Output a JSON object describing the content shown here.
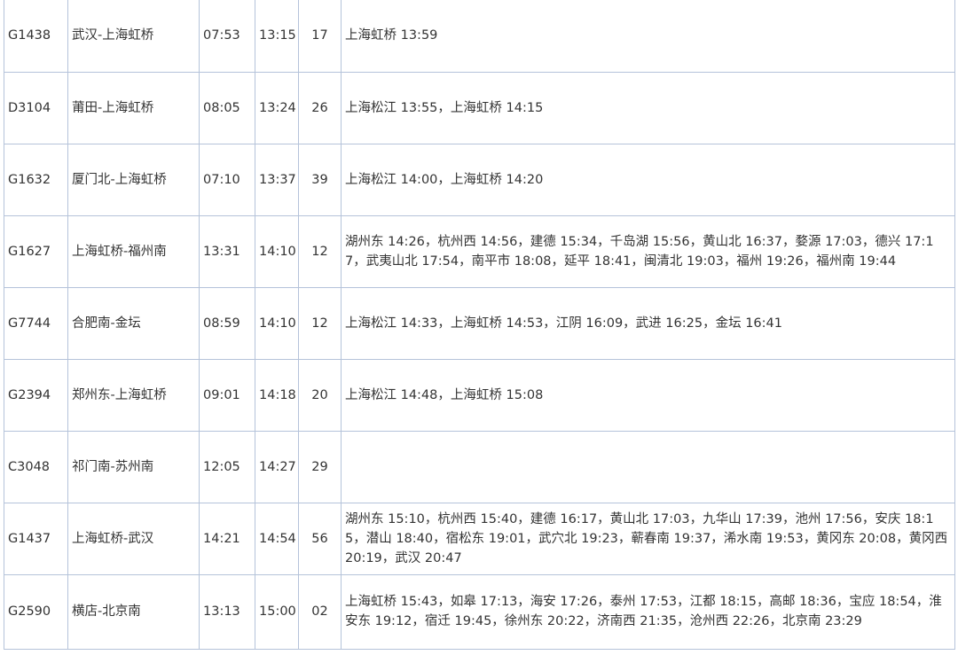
{
  "rows": [
    {
      "train": "G1438",
      "route": "武汉-上海虹桥",
      "depart": "07:53",
      "arrive": "13:15",
      "min": "17",
      "stops": "上海虹桥 13:59"
    },
    {
      "train": "D3104",
      "route": "莆田-上海虹桥",
      "depart": "08:05",
      "arrive": "13:24",
      "min": "26",
      "stops": "上海松江 13:55，上海虹桥 14:15"
    },
    {
      "train": "G1632",
      "route": "厦门北-上海虹桥",
      "depart": "07:10",
      "arrive": "13:37",
      "min": "39",
      "stops": "上海松江 14:00，上海虹桥 14:20"
    },
    {
      "train": "G1627",
      "route": "上海虹桥-福州南",
      "depart": "13:31",
      "arrive": "14:10",
      "min": "12",
      "stops": "湖州东 14:26，杭州西 14:56，建德 15:34，千岛湖 15:56，黄山北 16:37，婺源 17:03，德兴 17:17，武夷山北 17:54，南平市 18:08，延平 18:41，闽清北 19:03，福州 19:26，福州南 19:44"
    },
    {
      "train": "G7744",
      "route": "合肥南-金坛",
      "depart": "08:59",
      "arrive": "14:10",
      "min": "12",
      "stops": "上海松江 14:33，上海虹桥 14:53，江阴 16:09，武进 16:25，金坛 16:41"
    },
    {
      "train": "G2394",
      "route": "郑州东-上海虹桥",
      "depart": "09:01",
      "arrive": "14:18",
      "min": "20",
      "stops": "上海松江 14:48，上海虹桥 15:08"
    },
    {
      "train": "C3048",
      "route": "祁门南-苏州南",
      "depart": "12:05",
      "arrive": "14:27",
      "min": "29",
      "stops": ""
    },
    {
      "train": "G1437",
      "route": "上海虹桥-武汉",
      "depart": "14:21",
      "arrive": "14:54",
      "min": "56",
      "stops": "湖州东 15:10，杭州西 15:40，建德 16:17，黄山北 17:03，九华山 17:39，池州 17:56，安庆 18:15，潜山 18:40，宿松东 19:01，武穴北 19:23，蕲春南 19:37，浠水南 19:53，黄冈东 20:08，黄冈西 20:19，武汉 20:47"
    },
    {
      "train": "G2590",
      "route": "横店-北京南",
      "depart": "13:13",
      "arrive": "15:00",
      "min": "02",
      "stops": "上海虹桥 15:43，如皋 17:13，海安 17:26，泰州 17:53，江都 18:15，高邮 18:36，宝应 18:54，淮安东 19:12，宿迁 19:45，徐州东 20:22，济南西 21:35，沧州西 22:26，北京南 23:29"
    }
  ]
}
